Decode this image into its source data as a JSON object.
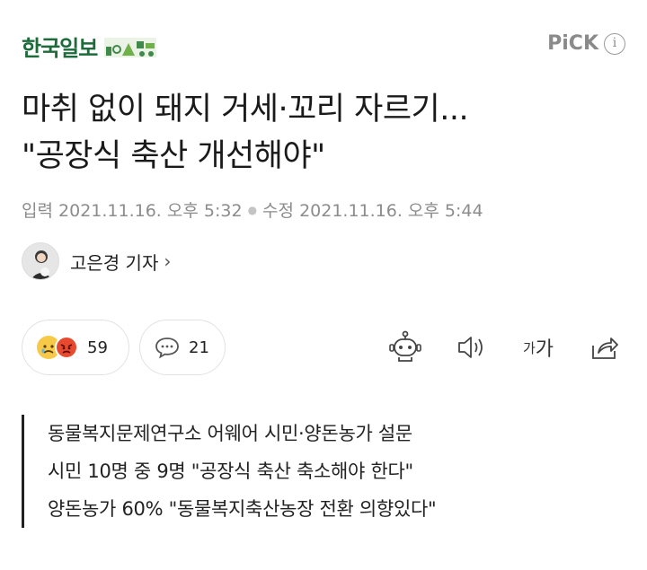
{
  "header": {
    "brand": "한국일보",
    "pick_label": "PiCK",
    "info_label": "i"
  },
  "article": {
    "title_line1": "마취 없이 돼지 거세·꼬리 자르기...",
    "title_line2": "\"공장식 축산 개선해야\"",
    "published_label": "입력",
    "published": "2021.11.16. 오후 5:32",
    "modified_label": "수정",
    "modified": "2021.11.16. 오후 5:44"
  },
  "reporter": {
    "name": "고은경 기자",
    "arrow": "›"
  },
  "actions": {
    "reaction_count": "59",
    "comment_count": "21",
    "fontsize_small": "가",
    "fontsize_large": "가"
  },
  "summary": {
    "lines": [
      "동물복지문제연구소 어웨어 시민·양돈농가 설문",
      "시민 10명 중 9명 \"공장식 축산 축소해야 한다\"",
      "양돈농가 60% \"동물복지축산농장 전환 의향있다\""
    ]
  }
}
